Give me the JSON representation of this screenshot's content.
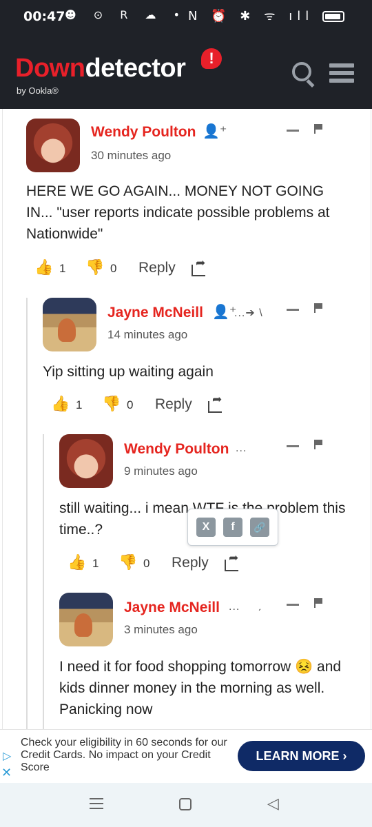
{
  "status_bar": {
    "time": "00:47",
    "left_icons": "☻ ⊙ R ☁ •",
    "right_icons": "N ⏰ ✱ ᯤ ıll"
  },
  "header": {
    "logo_part1": "Down",
    "logo_part2": "detector",
    "logo_badge": "!",
    "byline": "by Ookla®"
  },
  "comments": [
    {
      "author": "Wendy Poulton",
      "time": "30 minutes ago",
      "body": "HERE WE GO AGAIN... MONEY NOT GOING IN... \"user reports indicate possible problems at Nationwide\"",
      "likes": "1",
      "dislikes": "0",
      "reply_label": "Reply"
    },
    {
      "author": "Jayne McNeill",
      "time": "14 minutes ago",
      "body": "Yip sitting up waiting again",
      "likes": "1",
      "dislikes": "0",
      "reply_label": "Reply",
      "reply_hint": "...➔ \\"
    },
    {
      "author": "Wendy Poulton",
      "time": "9 minutes ago",
      "body": "still waiting... i mean WTF is the problem this time..?",
      "likes": "1",
      "dislikes": "0",
      "reply_label": "Reply",
      "more": "..."
    },
    {
      "author": "Jayne McNeill",
      "time": "3 minutes ago",
      "body": "I need it for food shopping tomorrow 😣 and kids dinner money in the morning as well. Panicking now",
      "more": "...",
      "reply_hint": "ˏ"
    }
  ],
  "share_popup": {
    "x_label": "X",
    "facebook_label": "f",
    "link_label": "🔗"
  },
  "ad": {
    "text": "Check your eligibility in 60 seconds for our Credit Cards. No impact on your Credit Score",
    "button": "LEARN MORE ›",
    "adchoice": "▷",
    "close": "✕"
  },
  "nav": {
    "back": "◁"
  },
  "colors": {
    "brand_red": "#e8202a",
    "header_bg": "#1f2228",
    "author_red": "#e5251f",
    "ad_button": "#0f2a66"
  }
}
